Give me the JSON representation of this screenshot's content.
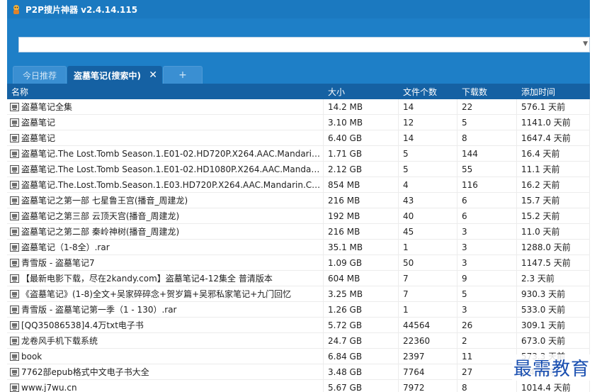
{
  "window": {
    "title": "P2P搜片神器 v2.4.14.115"
  },
  "search": {
    "value": "",
    "placeholder": ""
  },
  "tabs": [
    {
      "label": "今日推荐"
    },
    {
      "label": "盗墓笔记(搜索中)"
    },
    {
      "label": "+"
    }
  ],
  "tab_close": "✕",
  "columns": {
    "name": "名称",
    "size": "大小",
    "count": "文件个数",
    "downloads": "下载数",
    "time": "添加时间"
  },
  "rows": [
    {
      "name": "盗墓笔记全集",
      "size": "14.2 MB",
      "count": "14",
      "downloads": "22",
      "time": "576.1 天前"
    },
    {
      "name": "盗墓笔记",
      "size": "3.10 MB",
      "count": "12",
      "downloads": "5",
      "time": "1141.0 天前"
    },
    {
      "name": "盗墓笔记",
      "size": "6.40 GB",
      "count": "14",
      "downloads": "8",
      "time": "1647.4 天前"
    },
    {
      "name": "盗墓笔记.The Lost.Tomb Season.1.E01-02.HD720P.X264.AAC.Mandarin.CHS",
      "size": "1.71 GB",
      "count": "5",
      "downloads": "144",
      "time": "16.4 天前"
    },
    {
      "name": "盗墓笔记.The Lost.Tomb Season.1.E01-02.HD1080P.X264.AAC.Mandarin.CHS",
      "size": "2.12 GB",
      "count": "5",
      "downloads": "55",
      "time": "11.1 天前"
    },
    {
      "name": "盗墓笔记.The.Lost.Tomb.Season.1.E03.HD720P.X264.AAC.Mandarin.CHS",
      "size": "854 MB",
      "count": "4",
      "downloads": "116",
      "time": "16.2 天前"
    },
    {
      "name": "盗墓笔记之第一部 七星鲁王宫(播音_周建龙)",
      "size": "216 MB",
      "count": "43",
      "downloads": "6",
      "time": "15.7 天前"
    },
    {
      "name": "盗墓笔记之第三部 云顶天宫(播音_周建龙)",
      "size": "192 MB",
      "count": "40",
      "downloads": "6",
      "time": "15.2 天前"
    },
    {
      "name": "盗墓笔记之第二部 秦岭神树(播音_周建龙)",
      "size": "216 MB",
      "count": "45",
      "downloads": "3",
      "time": "11.0 天前"
    },
    {
      "name": "盗墓笔记（1-8全）.rar",
      "size": "35.1 MB",
      "count": "1",
      "downloads": "3",
      "time": "1288.0 天前"
    },
    {
      "name": "青雪版 - 盗墓笔记7",
      "size": "1.09 GB",
      "count": "50",
      "downloads": "3",
      "time": "1147.5 天前"
    },
    {
      "name": "【最新电影下载，尽在2kandy.com】盗墓笔记4-12集全 普清版本",
      "size": "604 MB",
      "count": "7",
      "downloads": "9",
      "time": "2.3 天前"
    },
    {
      "name": "《盗墓笔记》(1-8)全文+吴家碎碎念+贺岁篇+吴邪私家笔记+九门回忆",
      "size": "3.25 MB",
      "count": "7",
      "downloads": "5",
      "time": "930.3 天前"
    },
    {
      "name": "青雪版 - 盗墓笔记第一季（1 - 130）.rar",
      "size": "1.26 GB",
      "count": "1",
      "downloads": "3",
      "time": "533.0 天前"
    },
    {
      "name": "[QQ35086538]4.4万txt电子书",
      "size": "5.72 GB",
      "count": "44564",
      "downloads": "26",
      "time": "309.1 天前"
    },
    {
      "name": "龙卷风手机下载系统",
      "size": "24.7 GB",
      "count": "22360",
      "downloads": "2",
      "time": "673.0 天前"
    },
    {
      "name": "book",
      "size": "6.84 GB",
      "count": "2397",
      "downloads": "11",
      "time": "573.3 天前"
    },
    {
      "name": "7762部epub格式中文电子书大全",
      "size": "3.48 GB",
      "count": "7764",
      "downloads": "27",
      "time": "1.4 天前"
    },
    {
      "name": "www.j7wu.cn",
      "size": "5.67 GB",
      "count": "7972",
      "downloads": "8",
      "time": "1014.4 天前"
    }
  ],
  "watermark": "最需教育",
  "colors": {
    "titlebar": "#1b79c0",
    "header": "#1561a3",
    "watermark": "#1a4fb0"
  }
}
